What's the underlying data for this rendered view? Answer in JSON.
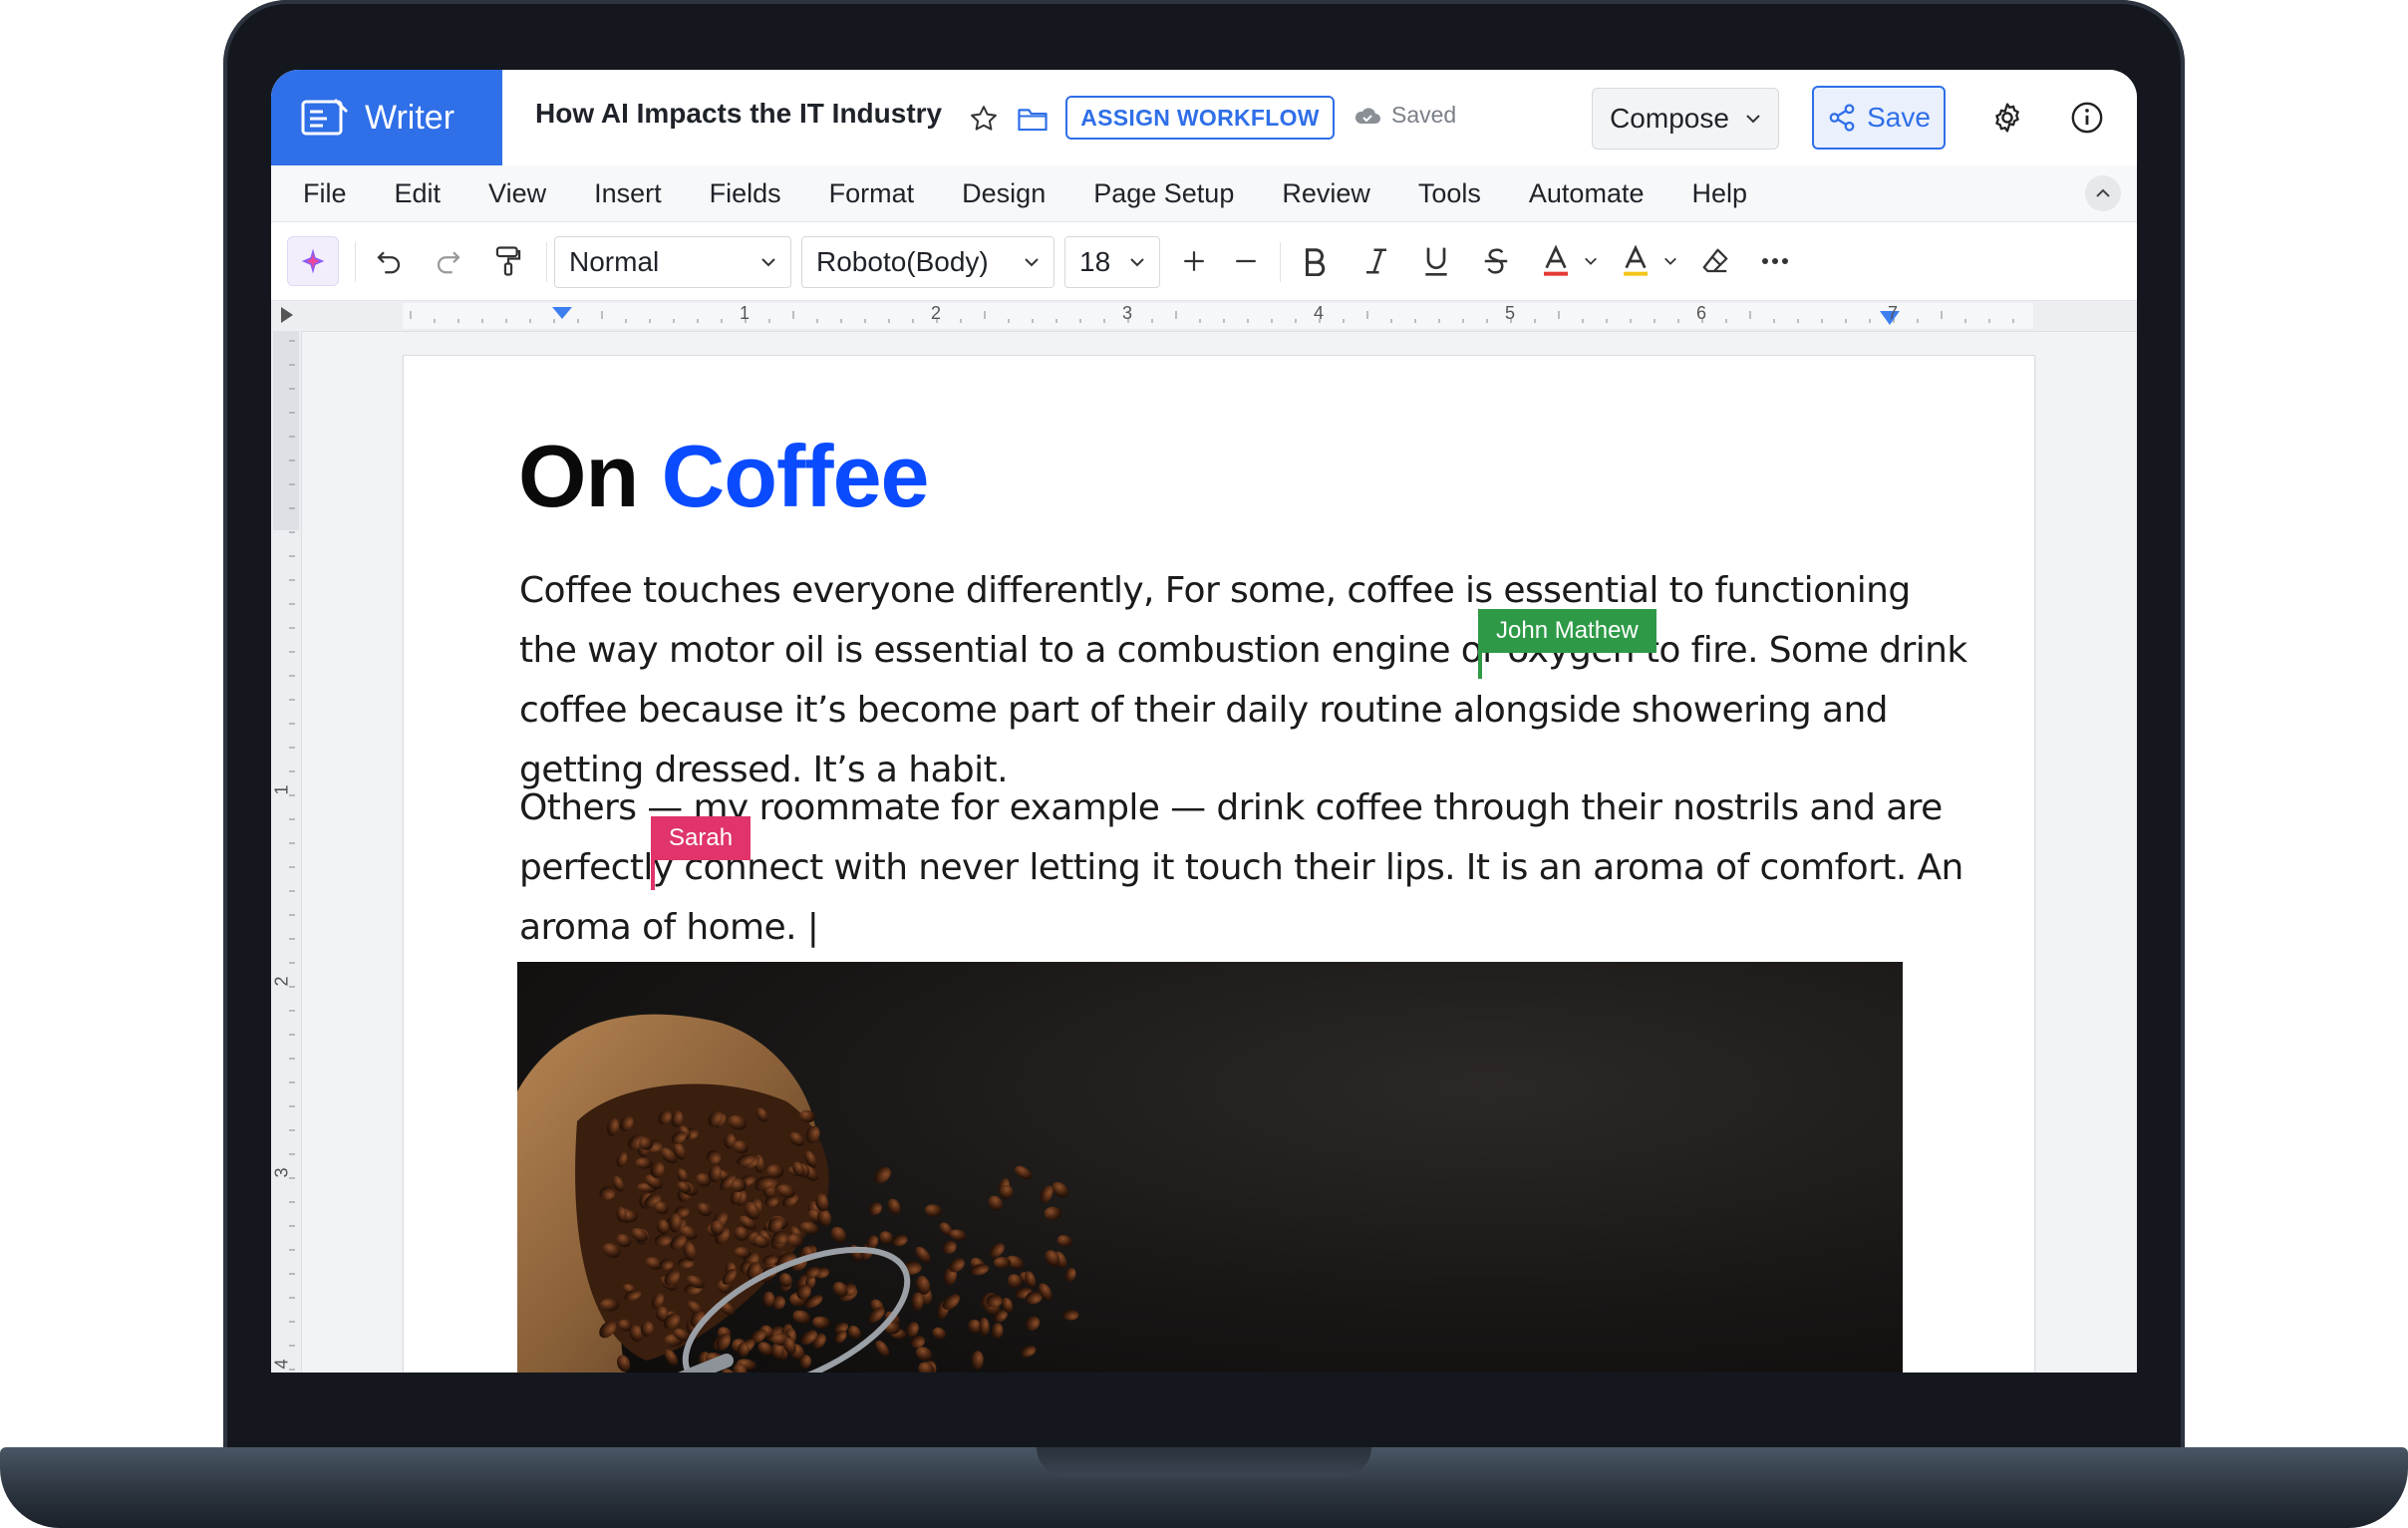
{
  "app": {
    "name": "Writer"
  },
  "document": {
    "title": "How AI Impacts the IT Industry",
    "status": "Saved",
    "heading_part1": "On",
    "heading_part2": "Coffee",
    "paragraph1": "Coffee touches everyone differently, For some, coffee is essential to functioning the way motor oil is essential to a combustion engine or oxygen to fire. Some drink coffee because it’s become part of their daily routine alongside showering and getting dressed. It’s a habit.",
    "paragraph2": "Others — my roommate for example — drink coffee through their nostrils and are perfectly connect with never letting it touch their lips. It is an aroma of comfort. An aroma of home. |"
  },
  "header": {
    "workflow_label": "ASSIGN WORKFLOW",
    "compose_label": "Compose",
    "save_label": "Save"
  },
  "menu": [
    "File",
    "Edit",
    "View",
    "Insert",
    "Fields",
    "Format",
    "Design",
    "Page Setup",
    "Review",
    "Tools",
    "Automate",
    "Help"
  ],
  "toolbar": {
    "style_value": "Normal",
    "font_value": "Roboto(Body)",
    "size_value": "18"
  },
  "ruler": {
    "marks": [
      "1",
      "2",
      "3",
      "4",
      "5",
      "6",
      "7"
    ],
    "vmarks": [
      "1",
      "2",
      "3",
      "4"
    ]
  },
  "collaborators": [
    {
      "name": "John Mathew",
      "color": "#2e9a47"
    },
    {
      "name": "Sarah",
      "color": "#e0346a"
    }
  ],
  "colors": {
    "brand": "#2f6fe8",
    "heading_accent": "#0a4bff"
  },
  "icons": [
    "writer-logo-icon",
    "star-icon",
    "folder-icon",
    "cloud-icon",
    "chevron-down-icon",
    "share-icon",
    "gear-icon",
    "info-icon",
    "ai-sparkle-icon",
    "undo-icon",
    "redo-icon",
    "format-painter-icon",
    "plus-icon",
    "minus-icon",
    "bold-icon",
    "italic-icon",
    "underline-icon",
    "strikethrough-icon",
    "text-color-icon",
    "highlight-icon",
    "eraser-icon",
    "more-icon"
  ]
}
